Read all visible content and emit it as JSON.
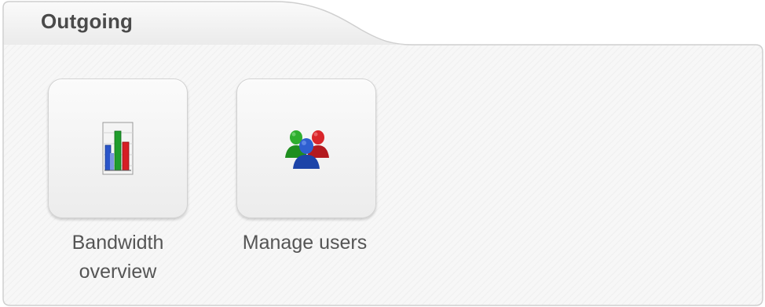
{
  "section": {
    "title": "Outgoing"
  },
  "tiles": [
    {
      "label_line1": "Bandwidth",
      "label_line2": "overview",
      "icon": "bar-chart-icon"
    },
    {
      "label_line1": "Manage users",
      "label_line2": "",
      "icon": "users-group-icon"
    }
  ],
  "colors": {
    "title_text": "#4a4a4a",
    "label_text": "#555555",
    "panel_border": "#cfcfcf",
    "panel_bg": "#f6f6f6"
  }
}
